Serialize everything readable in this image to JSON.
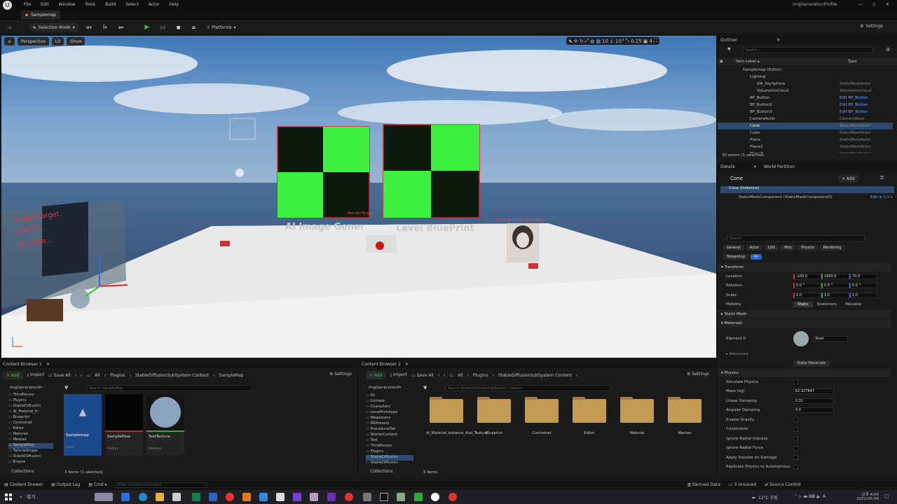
{
  "window": {
    "tab": "Samplemap",
    "profile": "ImgGenerationProfile",
    "min": "—",
    "max": "▫",
    "close": "✕"
  },
  "menu": [
    "File",
    "Edit",
    "Window",
    "Tools",
    "Build",
    "Select",
    "Actor",
    "Help"
  ],
  "toolbar": {
    "selection_mode": "Selection Mode",
    "platforms": "Platforms",
    "settings": "Settings"
  },
  "viewport": {
    "perspective": "Perspective",
    "lit": "Lit",
    "show": "Show",
    "grid": "10",
    "angle": "10°",
    "scale": "0.25",
    "cam": "4",
    "labels": {
      "ai": "AI Image Gener",
      "bp": "Level BluePrint",
      "render": "RenderTarget",
      "send": "Send to Image Generation",
      "select": "Select Target",
      "light": "Light C...",
      "edit": "(In Edito..."
    }
  },
  "outliner": {
    "title": "Outliner",
    "search": "Search...",
    "col_label": "Item Label ▴",
    "col_type": "Type",
    "rows": [
      {
        "name": "Samplemap (Editor)",
        "type": "",
        "indent": 0,
        "link": false,
        "sel": false
      },
      {
        "name": "Lighting",
        "type": "",
        "indent": 1,
        "link": false,
        "sel": false
      },
      {
        "name": "SM_SkySphere",
        "type": "StaticMeshActor",
        "indent": 2,
        "link": false,
        "sel": false
      },
      {
        "name": "VolumetricCloud",
        "type": "VolumetricCloud",
        "indent": 2,
        "link": false,
        "sel": false
      },
      {
        "name": "BP_Button",
        "type": "Edit BP_Button",
        "indent": 1,
        "link": true,
        "sel": false
      },
      {
        "name": "BP_Button2",
        "type": "Edit BP_Button",
        "indent": 1,
        "link": true,
        "sel": false
      },
      {
        "name": "BP_Button3",
        "type": "Edit BP_Button",
        "indent": 1,
        "link": true,
        "sel": false
      },
      {
        "name": "CameraActor",
        "type": "CameraActor",
        "indent": 1,
        "link": false,
        "sel": false
      },
      {
        "name": "Cone",
        "type": "StaticMeshActor",
        "indent": 1,
        "link": false,
        "sel": true
      },
      {
        "name": "Cube",
        "type": "StaticMeshActor",
        "indent": 1,
        "link": false,
        "sel": false
      },
      {
        "name": "Plane",
        "type": "StaticMeshActor",
        "indent": 1,
        "link": false,
        "sel": false
      },
      {
        "name": "Plane2",
        "type": "StaticMeshActor",
        "indent": 1,
        "link": false,
        "sel": false
      },
      {
        "name": "Plane3",
        "type": "StaticMeshActor",
        "indent": 1,
        "link": false,
        "sel": false
      }
    ],
    "count": "30 actors (1 selected)"
  },
  "details": {
    "tab": "Details",
    "tab2": "World Partition",
    "name": "Cone",
    "add": "+ Add",
    "instance": "Cone (Instance)",
    "component": "StaticMeshComponent (StaticMeshComponent0)",
    "edit_cpp": "Edit in C++",
    "search": "Search",
    "filters": [
      "General",
      "Actor",
      "LOD",
      "Misc",
      "Physics",
      "Rendering"
    ],
    "filters2": [
      "Streaming",
      "All"
    ],
    "transform": "Transform",
    "location": {
      "label": "Location",
      "x": "-100.0",
      "y": "1800.0",
      "z": "70.0"
    },
    "rotation": {
      "label": "Rotation",
      "x": "0.0 °",
      "y": "0.0 °",
      "z": "0.0 °"
    },
    "scale": {
      "label": "Scale",
      "x": "1.0",
      "y": "1.0",
      "z": "1.0"
    },
    "mobility": {
      "label": "Mobility",
      "opts": [
        "Static",
        "Stationary",
        "Movable"
      ]
    },
    "static_mesh": "Static Mesh",
    "materials": "Materials",
    "element0": "Element 0",
    "material": "Steel",
    "advanced": "Advanced",
    "bake": "Bake Materials",
    "physics": "Physics",
    "phys_rows": [
      {
        "label": "Simulate Physics",
        "val": ""
      },
      {
        "label": "Mass (kg)",
        "val": "62.927847"
      },
      {
        "label": "Linear Damping",
        "val": "0.01"
      },
      {
        "label": "Angular Damping",
        "val": "0.0"
      },
      {
        "label": "Enable Gravity",
        "val": ""
      },
      {
        "label": "Constraints",
        "val": ""
      },
      {
        "label": "Ignore Radial Impulse",
        "val": ""
      },
      {
        "label": "Ignore Radial Force",
        "val": ""
      },
      {
        "label": "Apply Impulse on Damage",
        "val": ""
      },
      {
        "label": "Replicate Physics to Autonomous",
        "val": ""
      }
    ]
  },
  "cb1": {
    "tab": "Content Browser 1",
    "add": "+ Add",
    "import": "Import",
    "save": "Save All",
    "path": [
      "All",
      "Plugins",
      "StableDiffusionSubSystem Content",
      "SampleMap"
    ],
    "settings": "Settings",
    "search": "Search SampleMap",
    "root": "ImgGenerationPr",
    "tree": [
      "ThirdPerson",
      "Plugins",
      "StableDiffusion",
      "AI_Material_In",
      "Blueprint",
      "Controlnet",
      "Editor",
      "Material",
      "Meshes",
      "SampleMap",
      "TutorialImage",
      "StableDiffusion",
      "Engine"
    ],
    "assets": [
      {
        "name": "Samplemap",
        "type": "Level"
      },
      {
        "name": "SamplePose",
        "type": "Texture"
      },
      {
        "name": "TestTexture",
        "type": "Material"
      }
    ],
    "count": "3 items (1 selected)",
    "collections": "Collections"
  },
  "cb2": {
    "tab": "Content Browser 2",
    "add": "+ Add",
    "import": "Import",
    "save": "Save All",
    "path": [
      "All",
      "Plugins",
      "StableDiffusionSubSystem Content"
    ],
    "settings": "Settings",
    "search": "Search StableDiffusionSubSystem Content",
    "root": "ImgGenerationPr",
    "tree": [
      "All",
      "Content",
      "Characters",
      "LevelPrototype",
      "Megascans",
      "MSPresets",
      "ProceduralTex",
      "StarterContent",
      "Test",
      "ThirdPerson",
      "Plugins",
      "StableDiffusion",
      "StableDiffusion"
    ],
    "folders": [
      "AI_Material_Instance_And_Texture",
      "Blueprint",
      "Controlnet",
      "Editor",
      "Material",
      "Meshes"
    ],
    "count": "9 items",
    "collections": "Collections"
  },
  "status": {
    "drawer": "Content Drawer",
    "output": "Output Log",
    "cmd": "Cmd",
    "console": "Enter Console Command",
    "derived": "Derived Data",
    "unsaved": "3 Unsaved",
    "source": "Source Control"
  },
  "taskbar": {
    "search": "찾기",
    "weather": "12°C 흐림",
    "time": "오후 4:00",
    "date": "2023-05-06"
  }
}
